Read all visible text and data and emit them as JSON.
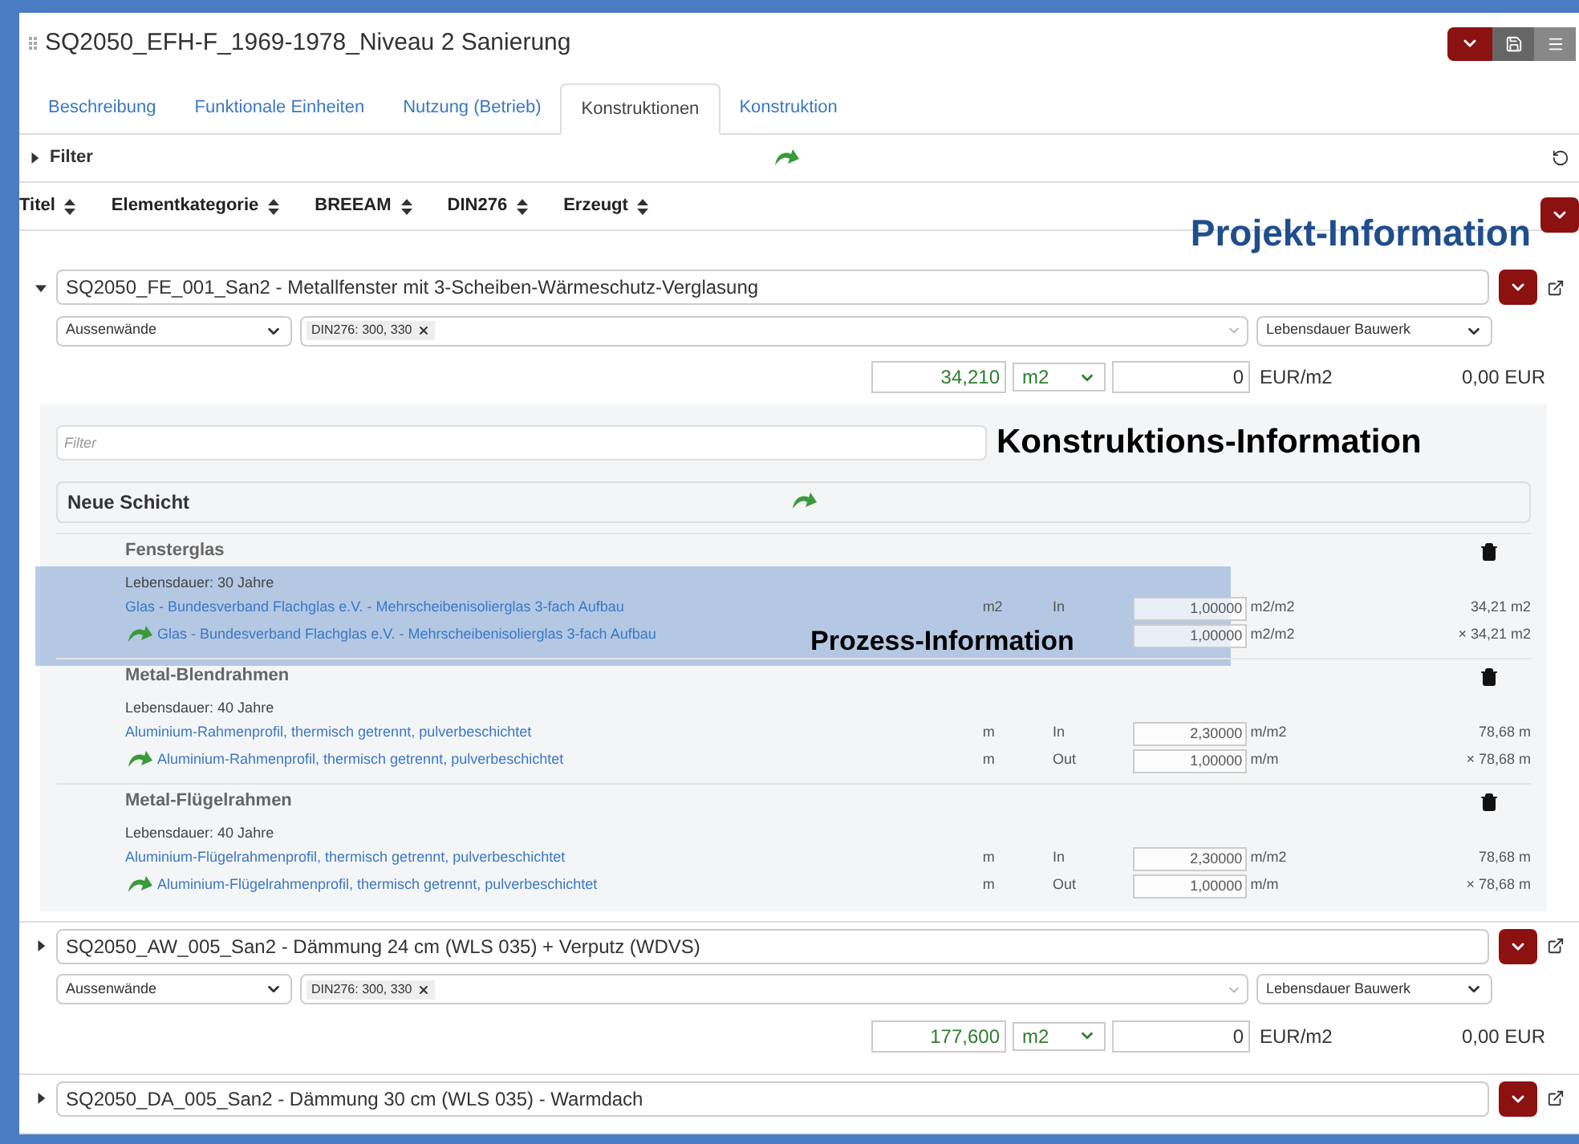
{
  "window": {
    "title": "SQ2050_EFH-F_1969-1978_Niveau 2 Sanierung"
  },
  "tabs": [
    {
      "label": "Beschreibung",
      "selected": false
    },
    {
      "label": "Funktionale Einheiten",
      "selected": false
    },
    {
      "label": "Nutzung (Betrieb)",
      "selected": false
    },
    {
      "label": "Konstruktionen",
      "selected": true
    },
    {
      "label": "Konstruktion",
      "selected": false
    }
  ],
  "filter": {
    "label": "Filter",
    "expanded": false
  },
  "sort_columns": [
    "Titel",
    "Elementkategorie",
    "BREEAM",
    "DIN276",
    "Erzeugt"
  ],
  "project_annotation": "Projekt-Information",
  "constructions": [
    {
      "title": "SQ2050_FE_001_San2 - Metallfenster mit 3-Scheiben-Wärmeschutz-Verglasung",
      "expanded": true,
      "category": "Aussenwände",
      "tag": "DIN276: 300, 330",
      "lifetime": "Lebensdauer Bauwerk",
      "quantity": "34,210",
      "unit": "m2",
      "price": "0",
      "price_unit": "EUR/m2",
      "total": "0,00 EUR",
      "filter_placeholder": "Filter",
      "new_layer": "Neue Schicht",
      "annotation": "Konstruktions-Information",
      "layers": [
        {
          "name": "Fensterglas",
          "lifetime": "Lebensdauer: 30 Jahre",
          "highlighted": true,
          "annotation": "Prozess-Information",
          "flows": [
            {
              "kind": "input",
              "name": "Glas - Bundesverband Flachglas e.V. - Mehrscheibenisolierglas 3-fach Aufbau",
              "unit": "m2",
              "direction": "In",
              "value": "1,00000",
              "value_unit": "m2/m2",
              "amount": "34,21 m2"
            },
            {
              "kind": "output",
              "name": "Glas - Bundesverband Flachglas e.V. - Mehrscheibenisolierglas 3-fach Aufbau",
              "value": "1,00000",
              "value_unit": "m2/m2",
              "amount": "× 34,21 m2"
            }
          ]
        },
        {
          "name": "Metal-Blendrahmen",
          "lifetime": "Lebensdauer: 40 Jahre",
          "highlighted": false,
          "flows": [
            {
              "kind": "input",
              "name": "Aluminium-Rahmenprofil, thermisch getrennt, pulverbeschichtet",
              "unit": "m",
              "direction": "In",
              "value": "2,30000",
              "value_unit": "m/m2",
              "amount": "78,68 m"
            },
            {
              "kind": "output",
              "name": "Aluminium-Rahmenprofil, thermisch getrennt, pulverbeschichtet",
              "unit": "m",
              "direction": "Out",
              "value": "1,00000",
              "value_unit": "m/m",
              "amount": "× 78,68 m"
            }
          ]
        },
        {
          "name": "Metal-Flügelrahmen",
          "lifetime": "Lebensdauer: 40 Jahre",
          "highlighted": false,
          "flows": [
            {
              "kind": "input",
              "name": "Aluminium-Flügelrahmenprofil, thermisch getrennt, pulverbeschichtet",
              "unit": "m",
              "direction": "In",
              "value": "2,30000",
              "value_unit": "m/m2",
              "amount": "78,68 m"
            },
            {
              "kind": "output",
              "name": "Aluminium-Flügelrahmenprofil, thermisch getrennt, pulverbeschichtet",
              "unit": "m",
              "direction": "Out",
              "value": "1,00000",
              "value_unit": "m/m",
              "amount": "× 78,68 m"
            }
          ]
        }
      ]
    },
    {
      "title": "SQ2050_AW_005_San2 - Dämmung 24 cm (WLS 035) + Verputz (WDVS)",
      "expanded": false,
      "category": "Aussenwände",
      "tag": "DIN276: 300, 330",
      "lifetime": "Lebensdauer Bauwerk",
      "quantity": "177,600",
      "unit": "m2",
      "price": "0",
      "price_unit": "EUR/m2",
      "total": "0,00 EUR"
    },
    {
      "title": "SQ2050_DA_005_San2 - Dämmung 30 cm (WLS 035) - Warmdach",
      "expanded": false
    }
  ]
}
